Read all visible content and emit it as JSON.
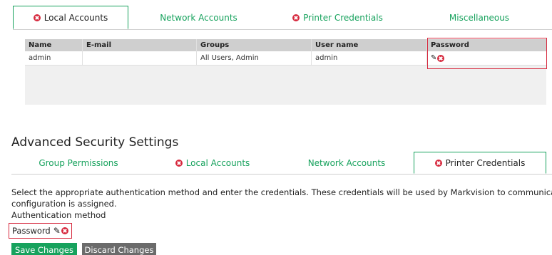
{
  "top_tabs": [
    {
      "label": "Local Accounts",
      "error": true,
      "active": true
    },
    {
      "label": "Network Accounts",
      "error": false,
      "active": false
    },
    {
      "label": "Printer Credentials",
      "error": true,
      "active": false
    },
    {
      "label": "Miscellaneous",
      "error": false,
      "active": false
    }
  ],
  "accounts_table": {
    "columns": [
      "Name",
      "E-mail",
      "Groups",
      "User name",
      "Password"
    ],
    "rows": [
      {
        "name": "admin",
        "email": "",
        "groups": "All Users, Admin",
        "username": "admin",
        "password_icons": [
          "pencil-icon",
          "error-icon"
        ]
      }
    ]
  },
  "section": {
    "title": "Advanced Security Settings"
  },
  "section_tabs": [
    {
      "label": "Group Permissions",
      "error": false,
      "active": false
    },
    {
      "label": "Local Accounts",
      "error": true,
      "active": false
    },
    {
      "label": "Network Accounts",
      "error": false,
      "active": false
    },
    {
      "label": "Printer Credentials",
      "error": true,
      "active": true
    }
  ],
  "printer_credentials": {
    "description_line1": "Select the appropriate authentication method and enter the credentials. These credentials will be used by Markvision to communicate with the se",
    "description_line2": "configuration is assigned.",
    "auth_label": "Authentication method",
    "auth_value": "Password"
  },
  "buttons": {
    "save": "Save Changes",
    "discard": "Discard Changes"
  },
  "colors": {
    "accent": "#17a25d",
    "error": "#d6283d",
    "discard": "#6b6b6b"
  }
}
